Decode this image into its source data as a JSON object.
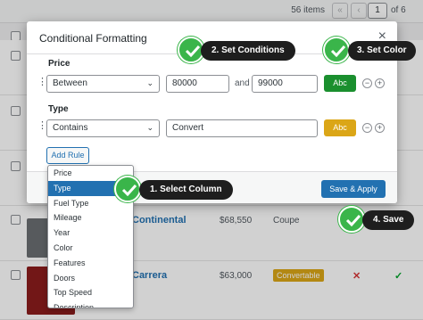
{
  "background": {
    "items_count": "56 items",
    "pager_first": "«",
    "pager_prev": "‹",
    "current_page": "1",
    "page_of": "of 6",
    "rows": [
      {
        "title": "Continental",
        "price": "$68,550",
        "type": "Coupe"
      },
      {
        "title": "Carrera",
        "price": "$63,000",
        "badge": "Convertable",
        "x_mark": "✕",
        "tick_mark": "✓"
      }
    ]
  },
  "modal": {
    "title": "Conditional Formatting",
    "close_label": "×",
    "price_section": {
      "label": "Price",
      "operator": "Between",
      "value_from": "80000",
      "and_text": "and",
      "value_to": "99000",
      "color_label": "Abc"
    },
    "type_section": {
      "label": "Type",
      "operator": "Contains",
      "value": "Convert",
      "color_label": "Abc"
    },
    "add_rule_label": "Add Rule",
    "save_label": "Save & Apply"
  },
  "column_dropdown": {
    "options": [
      "Price",
      "Type",
      "Fuel Type",
      "Mileage",
      "Year",
      "Color",
      "Features",
      "Doors",
      "Top Speed",
      "Description"
    ],
    "selected": "Type"
  },
  "callouts": {
    "step1": "1. Select Column",
    "step2": "2. Set Conditions",
    "step3": "3. Set Color",
    "step4": "4. Save"
  },
  "colors": {
    "accent": "#2271b1",
    "callout_bg": "#1e1e1e",
    "check_green": "#3ab54a",
    "price_color": "#1a8f2e",
    "type_color": "#dba617"
  }
}
